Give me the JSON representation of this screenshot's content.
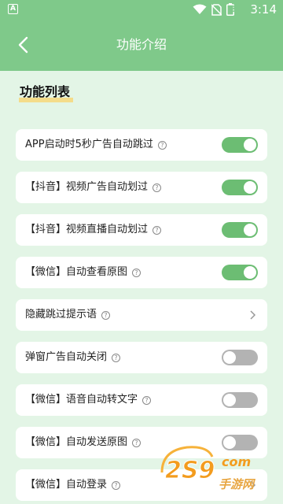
{
  "status_bar": {
    "notification_letter": "A",
    "battery_level": "3",
    "time": "3:14"
  },
  "app_bar": {
    "title": "功能介绍"
  },
  "section": {
    "title": "功能列表"
  },
  "items": [
    {
      "label": "APP启动时5秒广告自动跳过",
      "control": "toggle",
      "state": "on"
    },
    {
      "label": "【抖音】视频广告自动划过",
      "control": "toggle",
      "state": "on"
    },
    {
      "label": "【抖音】视频直播自动划过",
      "control": "toggle",
      "state": "on"
    },
    {
      "label": "【微信】自动查看原图",
      "control": "toggle",
      "state": "on"
    },
    {
      "label": "隐藏跳过提示语",
      "control": "chevron"
    },
    {
      "label": "弹窗广告自动关闭",
      "control": "toggle",
      "state": "off"
    },
    {
      "label": "【微信】语音自动转文字",
      "control": "toggle",
      "state": "off"
    },
    {
      "label": "【微信】自动发送原图",
      "control": "toggle",
      "state": "off"
    },
    {
      "label": "【微信】自动登录",
      "control": "chevron"
    }
  ],
  "help_glyph": "?",
  "watermark": {
    "brand": "2S9",
    "domain_suffix": "com",
    "subtitle": "手游网"
  },
  "colors": {
    "accent": "#7fc98a",
    "toggle_on": "#6cbd73",
    "toggle_off": "#b3b3b3",
    "background": "#e3f5e6",
    "underline": "#f4dc8a"
  }
}
